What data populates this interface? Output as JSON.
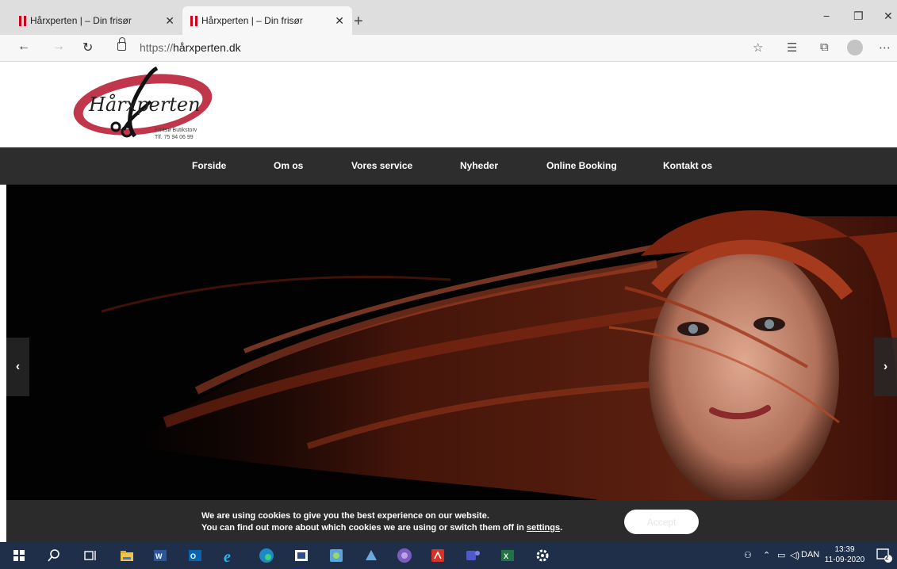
{
  "browser": {
    "tabs": [
      {
        "title": "Hårxperten | – Din frisør",
        "active": false
      },
      {
        "title": "Hårxperten | – Din frisør",
        "active": true
      }
    ],
    "new_tab_label": "+",
    "window_controls": {
      "minimize": "−",
      "restore": "❐",
      "close": "✕"
    },
    "url_prefix": "https://",
    "url_host": "hårxperten.dk"
  },
  "site": {
    "logo_text": "Hårxperten",
    "contact_line1": "Erritsø Butikstorv",
    "contact_line2": "Tlf. 75 94 06 99",
    "nav": [
      {
        "label": "Forside"
      },
      {
        "label": "Om os"
      },
      {
        "label": "Vores service"
      },
      {
        "label": "Nyheder"
      },
      {
        "label": "Online Booking"
      },
      {
        "label": "Kontakt os"
      }
    ],
    "slider_prev": "‹",
    "slider_next": "›"
  },
  "cookie_banner": {
    "line1": "We are using cookies to give you the best experience on our website.",
    "line2_prefix": "You can find out more about which cookies we are using or switch them off in ",
    "settings_link": "settings",
    "line2_suffix": ".",
    "accept_label": "Accept"
  },
  "taskbar": {
    "language": "DAN",
    "time": "13:39",
    "date": "11-09-2020",
    "notification_count": "2"
  }
}
